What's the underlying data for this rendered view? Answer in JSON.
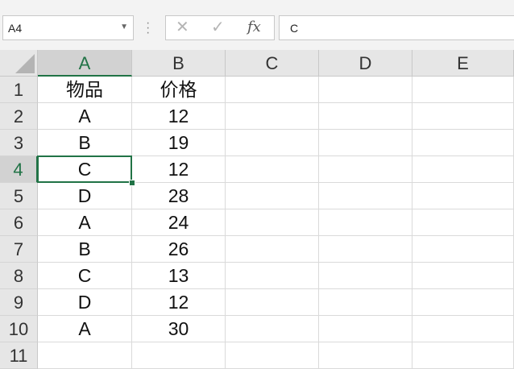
{
  "name_box": {
    "value": "A4"
  },
  "formula_bar": {
    "cancel": "✕",
    "enter": "✓",
    "fx": "fx",
    "content": "C"
  },
  "columns": [
    "A",
    "B",
    "C",
    "D",
    "E"
  ],
  "rows": [
    {
      "num": "1",
      "a": "物品",
      "b": "价格"
    },
    {
      "num": "2",
      "a": "A",
      "b": "12"
    },
    {
      "num": "3",
      "a": "B",
      "b": "19"
    },
    {
      "num": "4",
      "a": "C",
      "b": "12"
    },
    {
      "num": "5",
      "a": "D",
      "b": "28"
    },
    {
      "num": "6",
      "a": "A",
      "b": "24"
    },
    {
      "num": "7",
      "a": "B",
      "b": "26"
    },
    {
      "num": "8",
      "a": "C",
      "b": "13"
    },
    {
      "num": "9",
      "a": "D",
      "b": "12"
    },
    {
      "num": "10",
      "a": "A",
      "b": "30"
    },
    {
      "num": "11",
      "a": "",
      "b": ""
    }
  ],
  "selection": {
    "cell": "A4",
    "column": "A",
    "row": "4"
  },
  "colors": {
    "accent": "#217346",
    "header_bg": "#e6e6e6",
    "gridline": "#dadada"
  }
}
